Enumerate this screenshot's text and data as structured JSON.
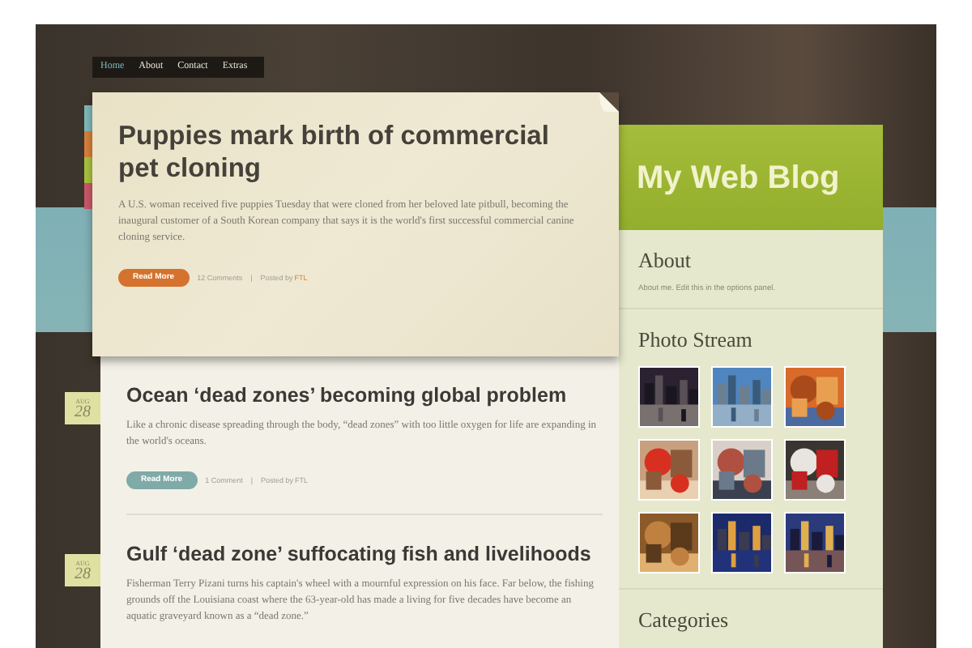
{
  "nav": [
    {
      "label": "Home",
      "selected": true
    },
    {
      "label": "About",
      "selected": false
    },
    {
      "label": "Contact",
      "selected": false
    },
    {
      "label": "Extras",
      "selected": false
    }
  ],
  "tabs": [
    {
      "color": "#7fb8bb"
    },
    {
      "color": "#d8803a"
    },
    {
      "color": "#a9c23c"
    },
    {
      "color": "#c9586a"
    }
  ],
  "featured": {
    "title": "Puppies mark birth of commercial pet cloning",
    "excerpt": "A U.S. woman received five puppies Tuesday that were cloned from her beloved late pitbull, becoming the inaugural customer of a South Korean company that says it is the world's first successful commercial canine cloning service.",
    "button": "Read More",
    "comments": "12 Comments",
    "separator": "|",
    "posted_by": "Posted by",
    "author": "FTL"
  },
  "posts": [
    {
      "month": "AUG",
      "day": "28",
      "title": "Ocean ‘dead zones’ becoming global problem",
      "excerpt": "Like a chronic disease spreading through the body, “dead zones” with too little oxygen for life are expanding in the world's oceans.",
      "button": "Read More",
      "comments": "1 Comment",
      "separator": "|",
      "posted_by": "Posted by",
      "author": "FTL"
    },
    {
      "month": "AUG",
      "day": "28",
      "title": "Gulf ‘dead zone’ suffocating fish and livelihoods",
      "excerpt": "Fisherman Terry Pizani turns his captain's wheel with a mournful expression on his face. Far below, the fishing grounds off the Louisiana coast where the 63-year-old has made a living for five decades have become an aquatic graveyard known as a “dead zone.”"
    }
  ],
  "sidebar": {
    "title": "My Web Blog",
    "widgets": [
      {
        "kind": "text",
        "heading": "About",
        "text": "About me. Edit this in the options panel."
      },
      {
        "kind": "photos",
        "heading": "Photo Stream"
      },
      {
        "kind": "heading",
        "heading": "Categories"
      }
    ]
  }
}
